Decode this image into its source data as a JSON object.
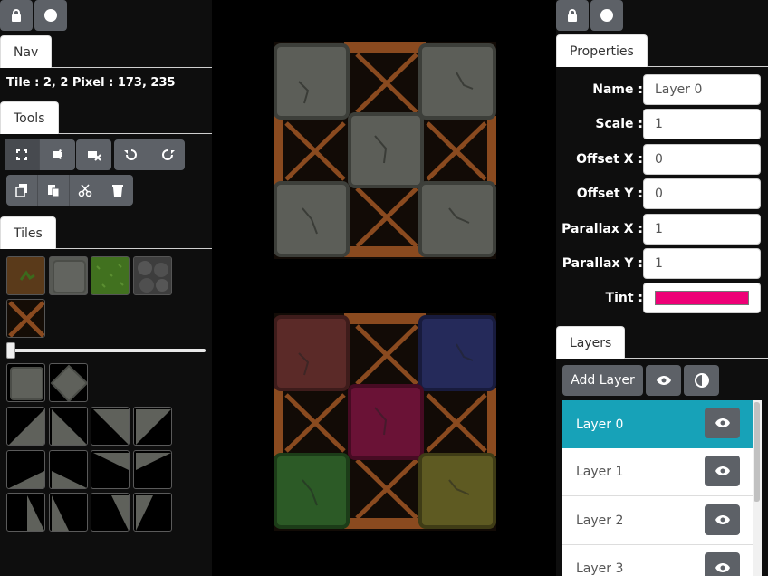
{
  "left": {
    "lock_icon": "lock-icon",
    "circle_icon": "circle-icon",
    "nav_tab": "Nav",
    "readout": "Tile : 2, 2 Pixel : 173, 235",
    "tools_tab": "Tools",
    "tools_row1": [
      "select-tool-icon",
      "stamp-tool-icon",
      "eraser-tool-icon",
      "undo-icon",
      "redo-icon"
    ],
    "tools_row2": [
      "copy-icon",
      "paste-icon",
      "cut-icon",
      "delete-icon"
    ],
    "tiles_tab": "Tiles",
    "tileset": [
      "dirt-grass-tile",
      "stone-tile",
      "grass-tile",
      "cobble-tile",
      "wood-cross-tile"
    ],
    "tile_size_slider_value": 0
  },
  "right": {
    "properties_tab": "Properties",
    "props": [
      {
        "label": "Name :",
        "value": "Layer 0"
      },
      {
        "label": "Scale :",
        "value": "1"
      },
      {
        "label": "Offset X :",
        "value": "0"
      },
      {
        "label": "Offset Y :",
        "value": "0"
      },
      {
        "label": "Parallax X :",
        "value": "1"
      },
      {
        "label": "Parallax Y :",
        "value": "1"
      },
      {
        "label": "Tint :",
        "value": ""
      }
    ],
    "tint_color": "#ee0077",
    "layers_tab": "Layers",
    "add_layer": "Add Layer",
    "layers": [
      {
        "name": "Layer 0",
        "selected": true
      },
      {
        "name": "Layer 1",
        "selected": false
      },
      {
        "name": "Layer 2",
        "selected": false
      },
      {
        "name": "Layer 3",
        "selected": false
      }
    ]
  },
  "colors": {
    "accent": "#17a2b8",
    "button": "#5d6167",
    "panel": "#0e0e0e"
  }
}
